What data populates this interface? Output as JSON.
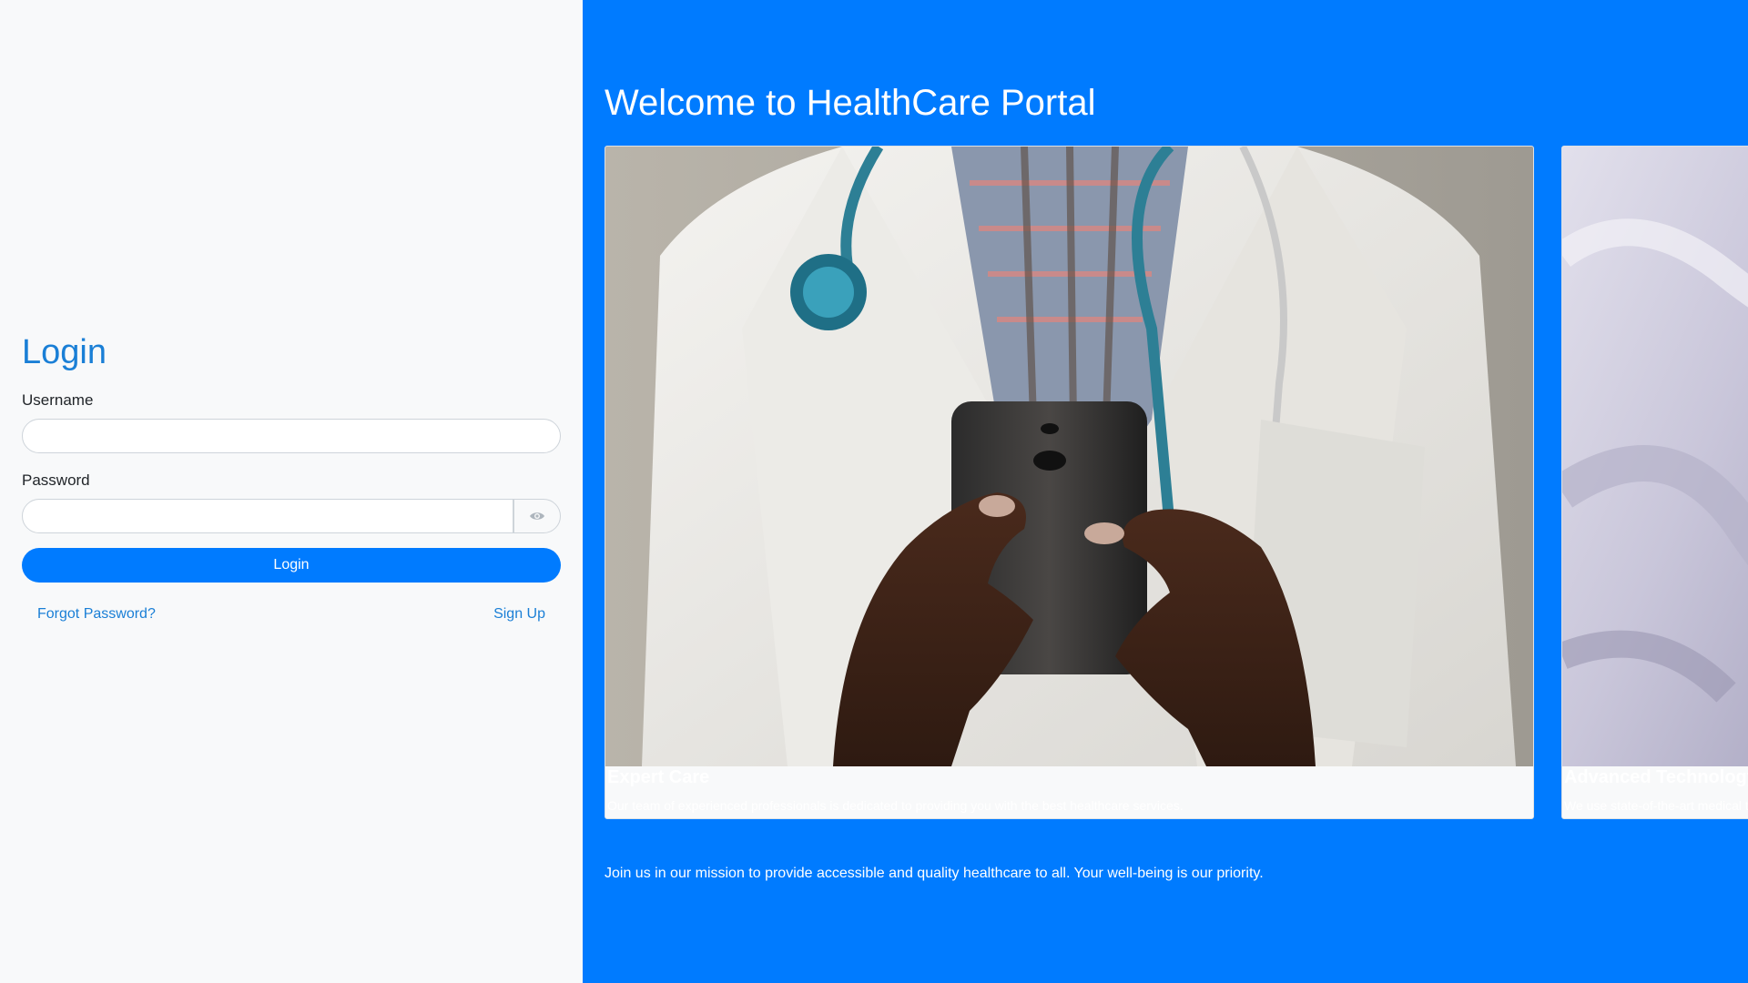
{
  "login": {
    "title": "Login",
    "username_label": "Username",
    "username_value": "",
    "password_label": "Password",
    "password_value": "",
    "login_button": "Login",
    "forgot_password": "Forgot Password?",
    "sign_up": "Sign Up"
  },
  "hero": {
    "title": "Welcome to HealthCare Portal",
    "cards": [
      {
        "title": "Expert Care",
        "text": "Our team of experienced professionals is dedicated to providing you with the best healthcare services.",
        "image": "doctor-with-phone-photo"
      },
      {
        "title": "Advanced Technology",
        "text": "We use state-of-the-art medical technology",
        "image": "hospital-bed-photo"
      }
    ],
    "mission": "Join us in our mission to provide accessible and quality healthcare to all. Your well-being is our priority."
  },
  "colors": {
    "primary": "#007bff",
    "link": "#1a7fd6",
    "panel_bg": "#f8f9fa"
  }
}
